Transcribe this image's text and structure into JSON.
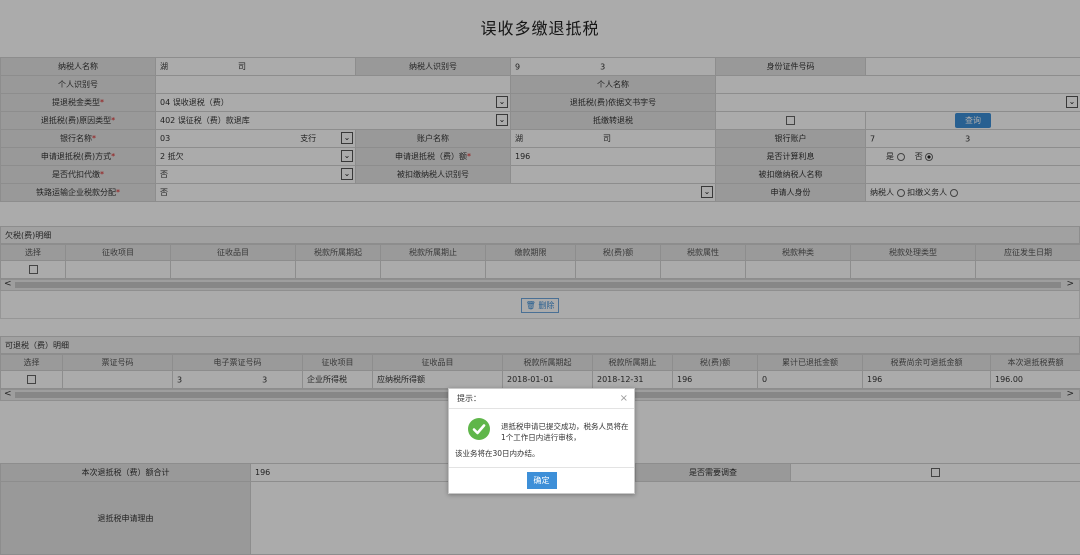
{
  "title": "误收多缴退抵税",
  "form": {
    "taxpayer_name_label": "纳税人名称",
    "taxpayer_name_value_tail": "司",
    "taxpayer_id_label": "纳税人识别号",
    "taxpayer_id_value_tail": "3",
    "id_number_label": "身份证件号码",
    "personal_id_label": "个人识别号",
    "personal_name_label": "个人名称",
    "refund_type_label": "提退税金类型",
    "refund_type_value": "04 误收退税（费）",
    "basis_doc_label": "退抵税(费)依据文书字号",
    "reason_label": "退抵税(费)原因类型",
    "reason_value": "402 误征税（费）款退库",
    "offset_label": "抵缴转退税",
    "query_button": "查询",
    "bank_name_label": "银行名称",
    "bank_name_prefix": "03",
    "bank_name_tail": "支行",
    "account_name_label": "账户名称",
    "account_name_prefix": "湖",
    "account_name_tail": "司",
    "bank_account_label": "银行账户",
    "bank_account_prefix": "7",
    "bank_account_tail": "3",
    "method_label": "申请退抵税(费)方式",
    "method_value": "2 抵欠",
    "amount_label": "申请退抵税（费）额",
    "amount_value": "196",
    "interest_label": "是否计算利息",
    "yes": "是",
    "no": "否",
    "withhold_label": "是否代扣代缴",
    "withhold_value": "否",
    "withheld_id_label": "被扣缴纳税人识别号",
    "withheld_name_label": "被扣缴纳税人名称",
    "rail_label": "铁路运输企业税款分配",
    "rail_value": "否",
    "applicant_label": "申请人身份",
    "applicant_opt1": "纳税人",
    "applicant_opt2": "扣缴义务人"
  },
  "arrears": {
    "title": "欠税(费)明细",
    "columns": [
      "选择",
      "征收项目",
      "征收品目",
      "税款所属期起",
      "税款所属期止",
      "缴款期限",
      "税(费)额",
      "税款属性",
      "税款种类",
      "税款处理类型",
      "应征发生日期"
    ],
    "delete_button": "删除"
  },
  "refundable": {
    "title": "可退税（费）明细",
    "columns": [
      "选择",
      "票证号码",
      "电子票证号码",
      "征收项目",
      "征收品目",
      "税款所属期起",
      "税款所属期止",
      "税(费)额",
      "累计已退抵金额",
      "税费尚余可退抵金额",
      "本次退抵税费额"
    ],
    "row": {
      "ticket_prefix": "3",
      "ticket_tail": "3",
      "item": "企业所得税",
      "subitem": "应纳税所得额",
      "period_start": "2018-01-01",
      "period_end": "2018-12-31",
      "amount": "196",
      "refunded": "0",
      "remaining": "196",
      "this_refund": "196.00"
    }
  },
  "summary": {
    "total_label": "本次退抵税（费）额合计",
    "total_value": "196",
    "survey_label": "是否需要调查",
    "reason_label": "退抵税申请理由"
  },
  "dialog": {
    "title": "提示：",
    "close": "×",
    "message": "退抵税申请已提交成功，税务人员将在1个工作日内进行审核，",
    "message2": "该业务将在30日内办结。",
    "ok_button": "确定"
  }
}
